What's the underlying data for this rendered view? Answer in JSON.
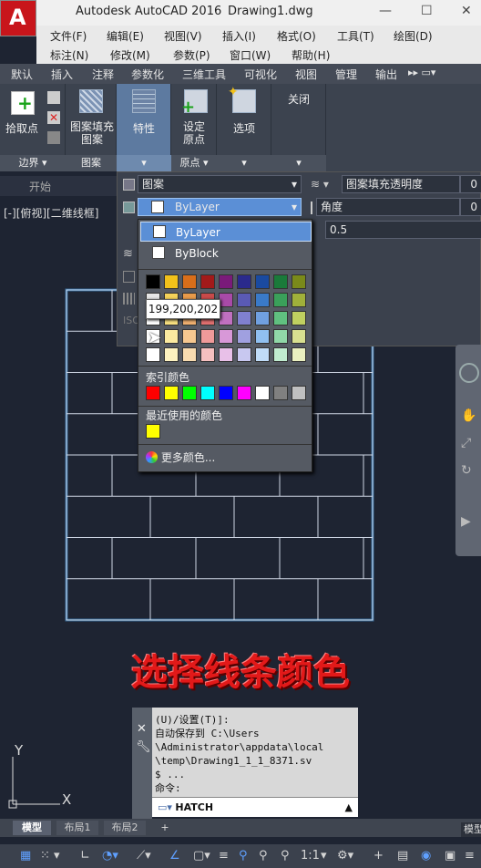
{
  "window": {
    "app_name": "Autodesk AutoCAD 2016",
    "doc_name": "Drawing1.dwg",
    "min": "—",
    "max": "☐",
    "close": "✕"
  },
  "menu": {
    "row1": [
      "文件(F)",
      "编辑(E)",
      "视图(V)",
      "插入(I)",
      "格式(O)",
      "工具(T)",
      "绘图(D)"
    ],
    "row2": [
      "标注(N)",
      "修改(M)",
      "参数(P)",
      "窗口(W)",
      "帮助(H)"
    ]
  },
  "ribbon_tabs": [
    "默认",
    "插入",
    "注释",
    "参数化",
    "三维工具",
    "可视化",
    "视图",
    "管理",
    "输出"
  ],
  "ribbon": {
    "pick_point": "拾取点",
    "boundary": "边界",
    "hatch_pattern": "图案填充",
    "hatch_pattern2": "图案",
    "pattern_panel": "图案",
    "properties": "特性",
    "set_origin": "设定",
    "set_origin2": "原点",
    "origin_panel": "原点",
    "options": "选项",
    "close": "关闭"
  },
  "start_tab": "开始",
  "view_label": "[-][俯视][二维线框]",
  "props": {
    "type_value": "图案",
    "color_value": "ByLayer",
    "transparency_label": "图案填充透明度",
    "transparency_value": "0",
    "angle_label": "角度",
    "angle_value": "0",
    "scale_value": "0.5",
    "ghost_label": "ISO"
  },
  "dropdown": {
    "items": [
      "ByLayer",
      "ByBlock"
    ],
    "index_title": "索引颜色",
    "recent_title": "最近使用的颜色",
    "more": "更多颜色...",
    "tooltip": "199,200,202"
  },
  "overlay_text": "选择线条颜色",
  "command": {
    "lines": [
      "(U)/设置(T)]:",
      "自动保存到 C:\\Users",
      "\\Administrator\\appdata\\local",
      "\\temp\\Drawing1_1_1_8371.sv",
      "$ ...",
      "命令:"
    ],
    "input_value": "HATCH"
  },
  "layout_tabs": [
    "模型",
    "布局1",
    "布局2",
    "+"
  ],
  "status_right": "模型",
  "scale": "1:1",
  "colors": {
    "accent": "#5b8fd6",
    "overlay": "#e21919",
    "hatch_line": "#cfd6e4",
    "boundary": "#4aa3e8"
  }
}
